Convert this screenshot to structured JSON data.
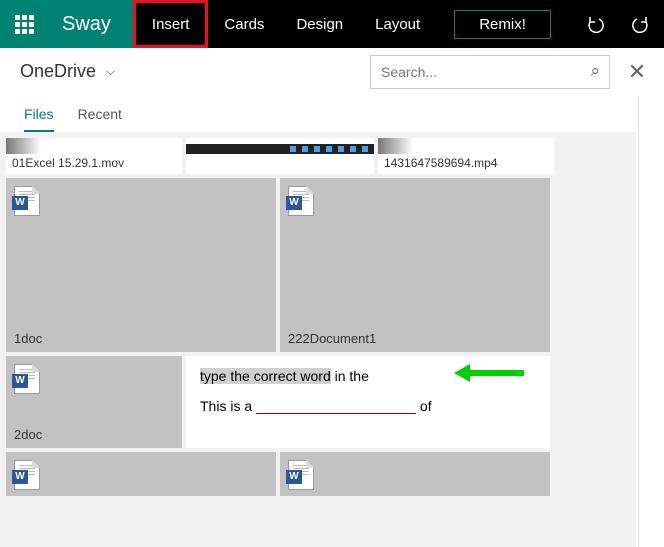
{
  "app": {
    "name": "Sway"
  },
  "menu": {
    "insert": "Insert",
    "cards": "Cards",
    "design": "Design",
    "layout": "Layout",
    "remix": "Remix!"
  },
  "source": {
    "location": "OneDrive",
    "search_placeholder": "Search..."
  },
  "viewtabs": {
    "files": "Files",
    "recent": "Recent"
  },
  "items": {
    "vid1": "01Excel 15.29.1.mov",
    "vid2": "",
    "vid3": "1431647589694.mp4",
    "doc1": "1doc",
    "doc2": "222Document1",
    "doc3": "2doc",
    "img_line1_hl": "type the correct word",
    "img_line1_rest": " in the",
    "img_line2_a": "This is a ",
    "img_line2_b": "of"
  }
}
